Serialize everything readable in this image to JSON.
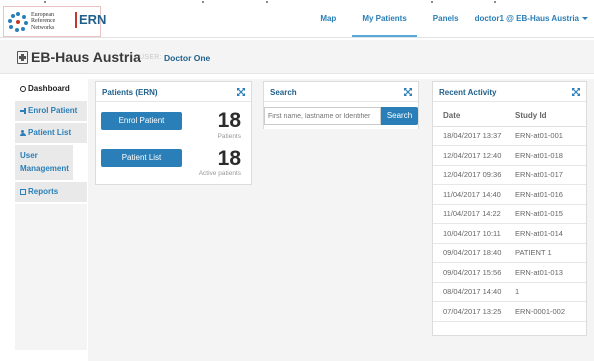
{
  "logo": {
    "org_line1": "European",
    "org_line2": "Reference",
    "org_line3": "Networks",
    "acronym": "ERN"
  },
  "nav": {
    "items": [
      {
        "label": "Map"
      },
      {
        "label": "My Patients"
      },
      {
        "label": "Panels"
      },
      {
        "label": "doctor1 @ EB-Haus Austria"
      }
    ]
  },
  "header": {
    "title": "EB-Haus Austria",
    "user_label": "USER:",
    "user_name": "Doctor One"
  },
  "sidebar": {
    "items": [
      {
        "label": "Dashboard",
        "icon": "dashboard-icon"
      },
      {
        "label": "Enrol Patient",
        "icon": "sign-in-icon"
      },
      {
        "label": "Patient List",
        "icon": "user-icon"
      },
      {
        "label": "User Management",
        "icon": ""
      },
      {
        "label": "Reports",
        "icon": "report-icon"
      }
    ]
  },
  "patients_panel": {
    "title": "Patients (ERN)",
    "enrol_button": "Enrol Patient",
    "list_button": "Patient List",
    "patients_count": "18",
    "patients_label": "Patients",
    "active_count": "18",
    "active_label": "Active patients"
  },
  "search_panel": {
    "title": "Search",
    "placeholder": "First name, lastname or Identifier",
    "button": "Search"
  },
  "activity_panel": {
    "title": "Recent Activity",
    "columns": [
      "Date",
      "Study Id"
    ],
    "rows": [
      [
        "18/04/2017 13:37",
        "ERN-at01-001"
      ],
      [
        "12/04/2017 12:40",
        "ERN-at01-018"
      ],
      [
        "12/04/2017 09:36",
        "ERN-at01-017"
      ],
      [
        "11/04/2017 14:40",
        "ERN-at01-016"
      ],
      [
        "11/04/2017 14:22",
        "ERN-at01-015"
      ],
      [
        "10/04/2017 10:11",
        "ERN-at01-014"
      ],
      [
        "09/04/2017 18:40",
        "PATIENT 1"
      ],
      [
        "09/04/2017 15:56",
        "ERN-at01-013"
      ],
      [
        "08/04/2017 14:40",
        "1"
      ],
      [
        "07/04/2017 13:25",
        "ERN-0001-002"
      ]
    ]
  },
  "colors": {
    "brand_blue": "#2a7fb8",
    "title_blue": "#1f5f8b",
    "panel_bg": "#f4f4f4"
  }
}
